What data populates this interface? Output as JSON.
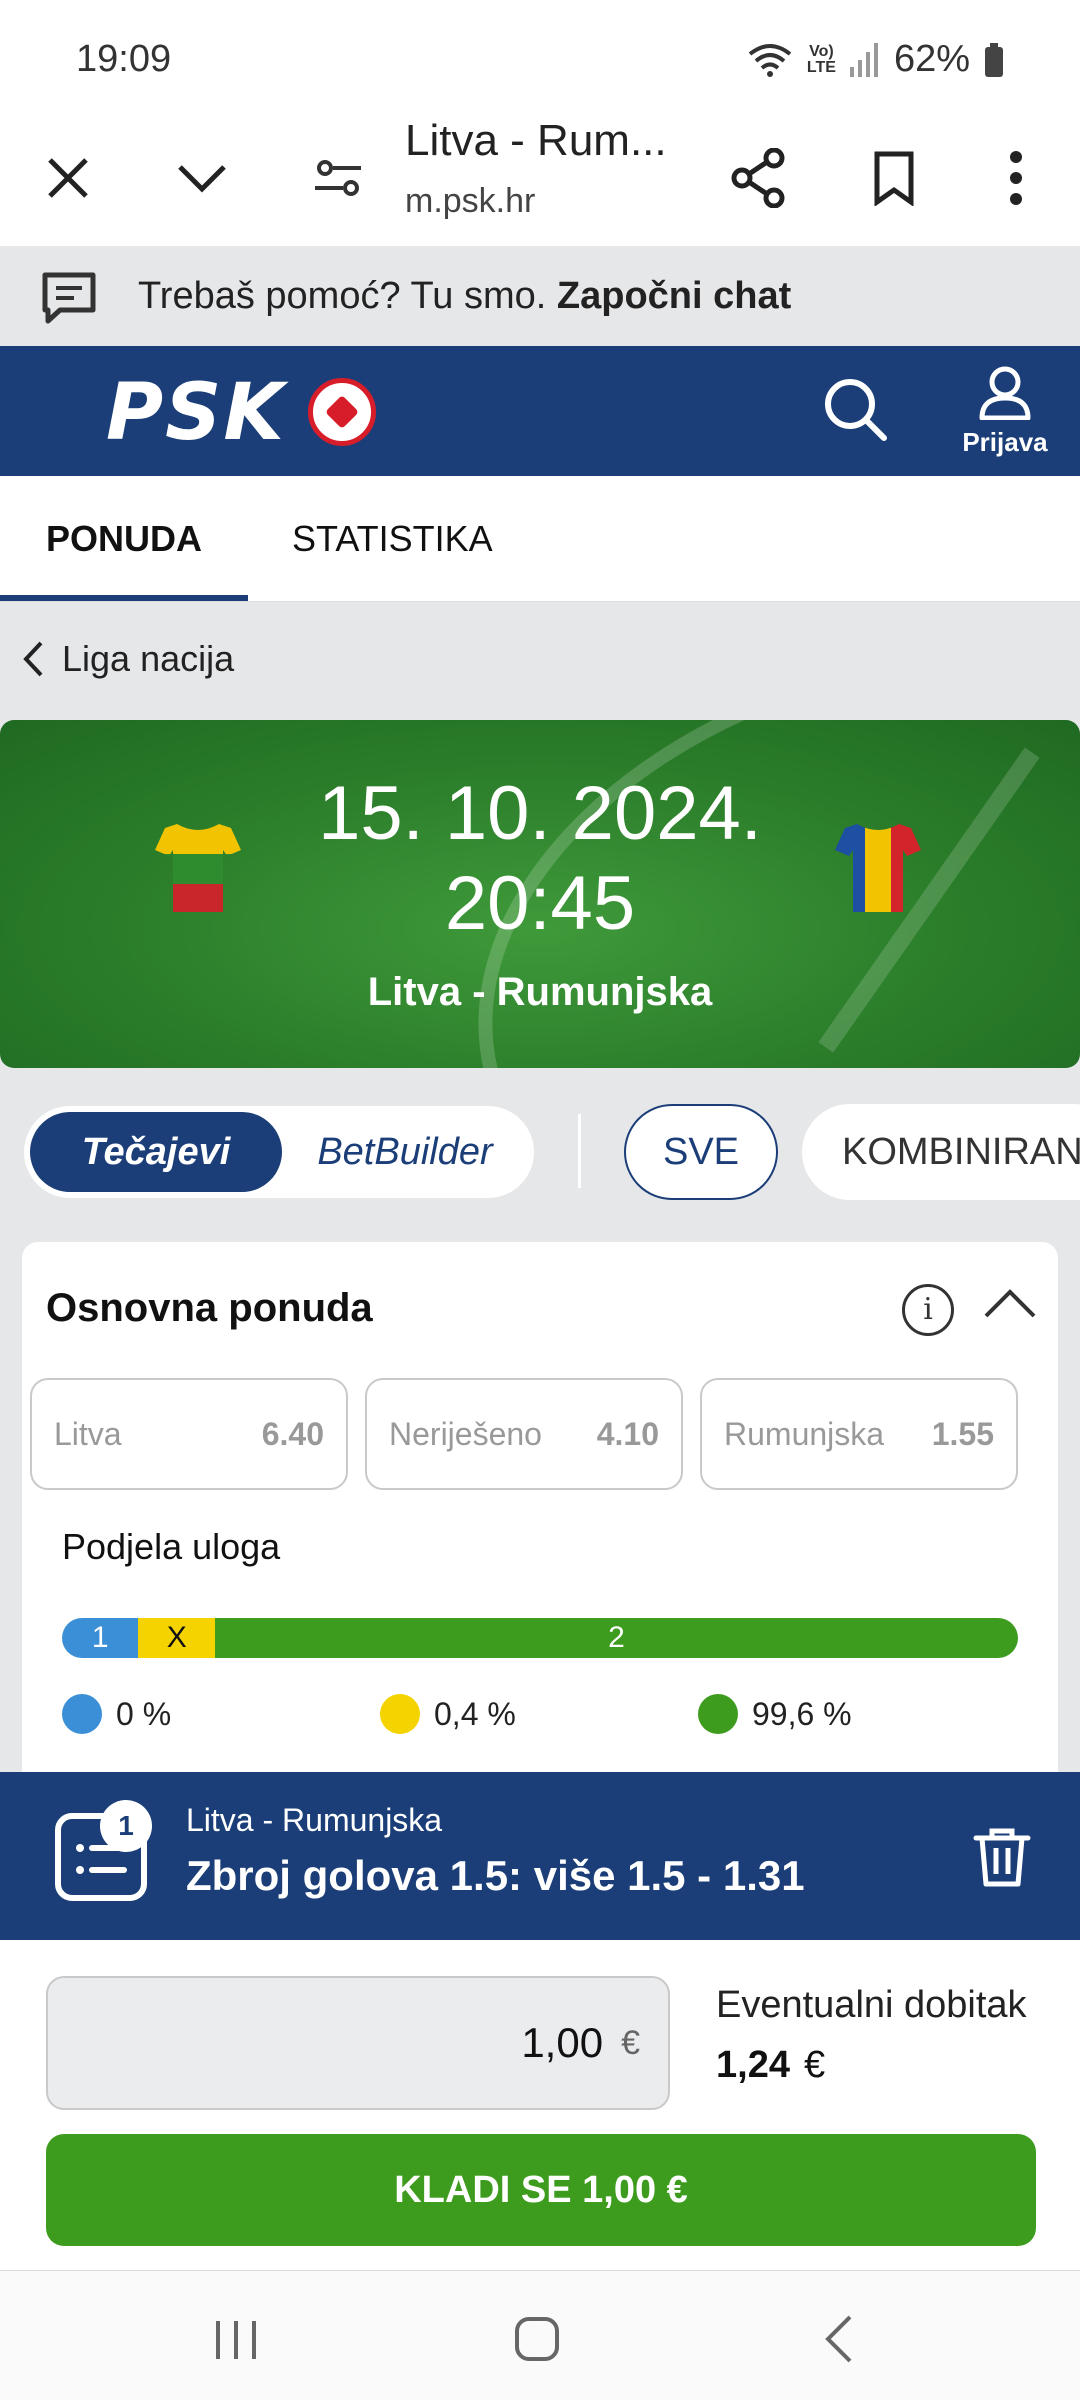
{
  "status_bar": {
    "time": "19:09",
    "battery": "62%",
    "lte_label": "Vo)\nLTE"
  },
  "browser": {
    "title": "Litva - Rum...",
    "url": "m.psk.hr"
  },
  "help_bar": {
    "text": "Trebaš pomoć? Tu smo.",
    "link": "Započni chat"
  },
  "header": {
    "logo": "PSK",
    "login_label": "Prijava"
  },
  "tabs": [
    {
      "label": "PONUDA",
      "active": true
    },
    {
      "label": "STATISTIKA",
      "active": false
    }
  ],
  "breadcrumb": "Liga nacija",
  "match": {
    "date": "15. 10. 2024.",
    "time": "20:45",
    "teams": "Litva - Rumunjska",
    "home_colors": [
      "#f2c300",
      "#2e8b2e",
      "#c8262b"
    ],
    "away_colors": [
      "#1d4fa3",
      "#f2c300",
      "#d3242c"
    ]
  },
  "filters": {
    "tecajevi": "Tečajevi",
    "betbuilder": "BetBuilder",
    "sve": "SVE",
    "kombinirano": "KOMBINIRAN"
  },
  "market": {
    "title": "Osnovna ponuda",
    "info_symbol": "i",
    "odds": [
      {
        "name": "Litva",
        "value": "6.40"
      },
      {
        "name": "Neriješeno",
        "value": "4.10"
      },
      {
        "name": "Rumunjska",
        "value": "1.55"
      }
    ],
    "split_title": "Podjela uloga",
    "split": [
      {
        "label": "1",
        "share": 0.08,
        "color": "#3a8fd6",
        "text_color": "#ffffff",
        "pct": "0 %"
      },
      {
        "label": "X",
        "share": 0.08,
        "color": "#f5d300",
        "text_color": "#111111",
        "pct": "0,4 %"
      },
      {
        "label": "2",
        "share": 0.84,
        "color": "#3d9b1d",
        "text_color": "#ffffff",
        "pct": "99,6 %"
      }
    ]
  },
  "betslip": {
    "count": "1",
    "match": "Litva - Rumunjska",
    "selection": "Zbroj golova 1.5:  više 1.5 - 1.31",
    "stake": "1,00",
    "currency": "€",
    "win_label": "Eventualni dobitak",
    "win_value": "1,24",
    "bet_button": "KLADI SE 1,00 €"
  },
  "colors": {
    "brand": "#1b3e78",
    "accent_green": "#3d9b1d"
  }
}
